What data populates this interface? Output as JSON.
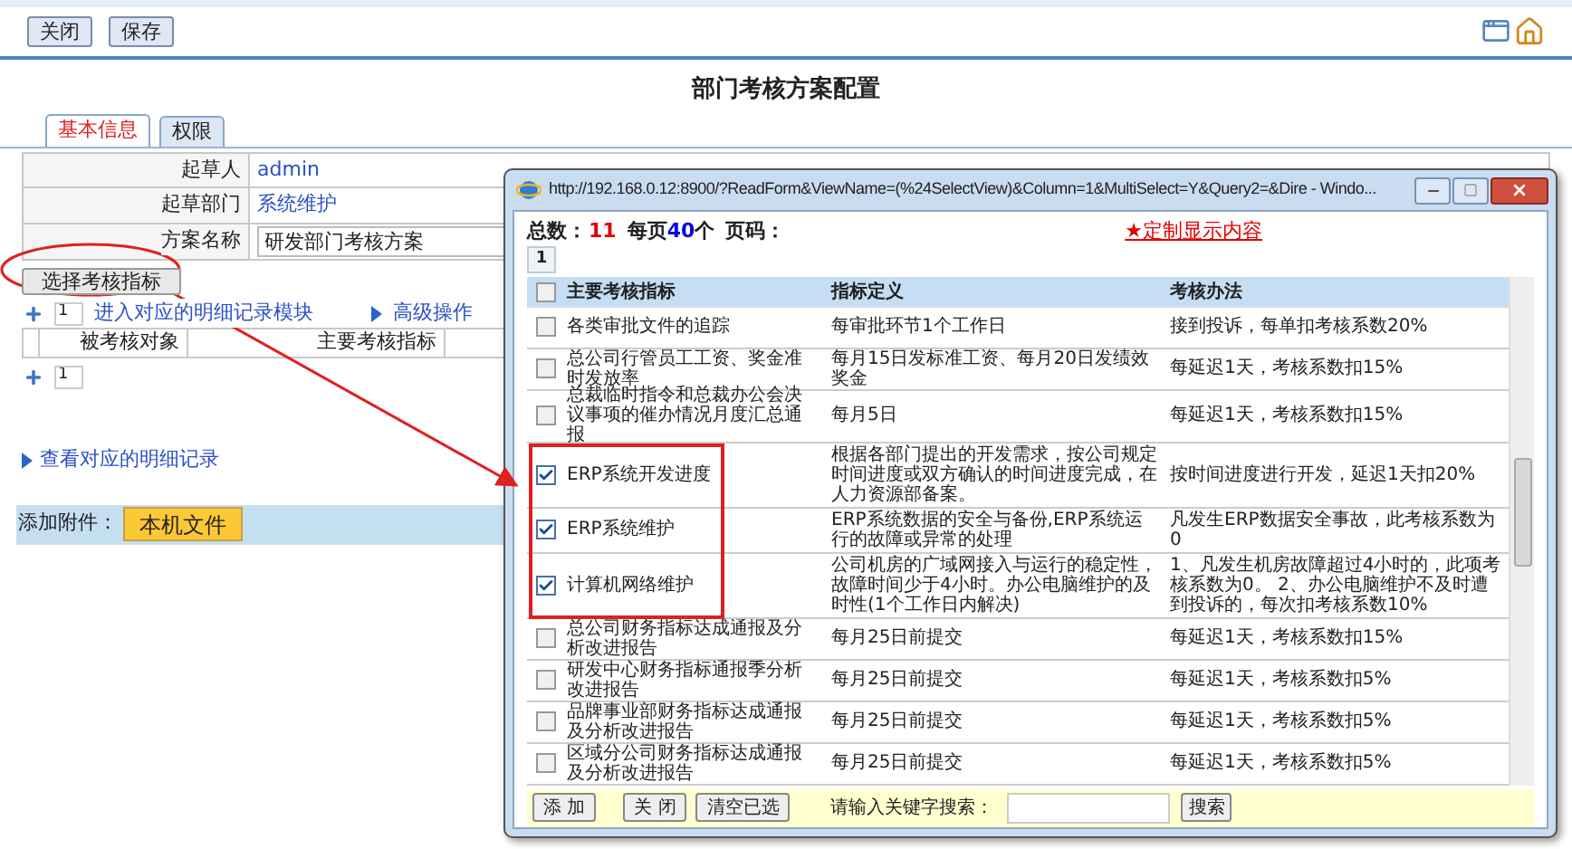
{
  "toolbar": {
    "buttons": [
      "关闭",
      "保存"
    ]
  },
  "page_title": "部门考核方案配置",
  "tabs": [
    {
      "label": "基本信息",
      "selected": true
    },
    {
      "label": "权限",
      "selected": false
    }
  ],
  "form": {
    "fields": [
      {
        "label": "起草人",
        "value": "admin",
        "kind": "text"
      },
      {
        "label": "起草部门",
        "value": "系统维护",
        "kind": "text"
      },
      {
        "label": "方案名称",
        "value": "研发部门考核方案",
        "kind": "input"
      }
    ]
  },
  "select_button": "选择考核指标",
  "detail": {
    "count_input": "1",
    "links": [
      "进入对应的明细记录模块",
      "高级操作"
    ],
    "columns": [
      "被考核对象",
      "主要考核指标"
    ],
    "row_input": "1"
  },
  "view_link": "查看对应的明细记录",
  "attachment": {
    "label": "添加附件：",
    "button": "本机文件"
  },
  "popup": {
    "title": "http://192.168.0.12:8900/?ReadForm&ViewName=(%24SelectView)&Column=1&MultiSelect=Y&Query2=&Dire - Windo...",
    "total_label": "总数：",
    "total": "11",
    "per_page_prefix": "每页",
    "per_page": "40",
    "per_page_suffix": "个",
    "page_label": "页码：",
    "pages": [
      {
        "label": "1",
        "selected": true
      }
    ],
    "custom_link": "★定制显示内容",
    "header_checked": false,
    "columns": [
      "主要考核指标",
      "指标定义",
      "考核办法"
    ],
    "rows": [
      {
        "indicator": "各类审批文件的追踪",
        "definition": "每审批环节1个工作日",
        "method": "接到投诉，每单扣考核系数20%",
        "checked": false
      },
      {
        "indicator": "总公司行管员工工资、奖金准时发放率",
        "definition": "每月15日发标准工资、每月20日发绩效奖金",
        "method": "每延迟1天，考核系数扣15%",
        "checked": false
      },
      {
        "indicator": "总裁临时指令和总裁办公会决议事项的催办情况月度汇总通报",
        "definition": "每月5日",
        "method": "每延迟1天，考核系数扣15%",
        "checked": false
      },
      {
        "indicator": "ERP系统开发进度",
        "definition": "根据各部门提出的开发需求，按公司规定时间进度或双方确认的时间进度完成，在人力资源部备案。",
        "method": "按时间进度进行开发，延迟1天扣20%",
        "checked": true
      },
      {
        "indicator": "ERP系统维护",
        "definition": "ERP系统数据的安全与备份,ERP系统运行的故障或异常的处理",
        "method": "凡发生ERP数据安全事故，此考核系数为0",
        "checked": true
      },
      {
        "indicator": "计算机网络维护",
        "definition": "公司机房的广域网接入与运行的稳定性，故障时间少于4小时。办公电脑维护的及时性(1个工作日内解决)",
        "method": "1、凡发生机房故障超过4小时的，此项考核系数为0。 2、办公电脑维护不及时遭到投诉的，每次扣考核系数10%",
        "checked": true
      },
      {
        "indicator": "总公司财务指标达成通报及分析改进报告",
        "definition": "每月25日前提交",
        "method": "每延迟1天，考核系数扣15%",
        "checked": false
      },
      {
        "indicator": "研发中心财务指标通报季分析改进报告",
        "definition": "每月25日前提交",
        "method": "每延迟1天，考核系数扣5%",
        "checked": false
      },
      {
        "indicator": "品牌事业部财务指标达成通报及分析改进报告",
        "definition": "每月25日前提交",
        "method": "每延迟1天，考核系数扣5%",
        "checked": false
      },
      {
        "indicator": "区域分公司财务指标达成通报及分析改进报告",
        "definition": "每月25日前提交",
        "method": "每延迟1天，考核系数扣5%",
        "checked": false
      }
    ],
    "buttons": [
      "添 加",
      "关 闭",
      "清空已选"
    ],
    "search_label": "请输入关键字搜索：",
    "search_button": "搜索"
  }
}
